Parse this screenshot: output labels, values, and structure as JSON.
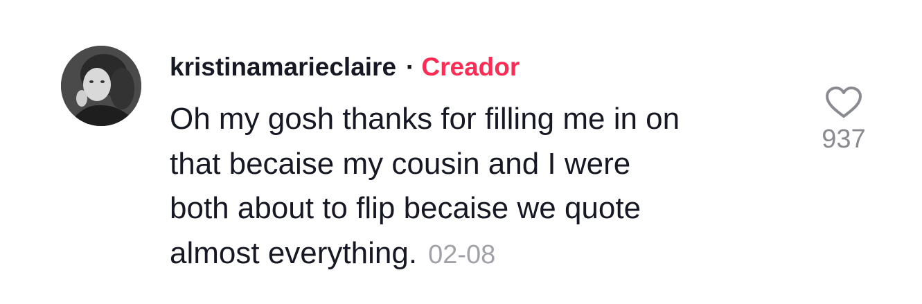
{
  "comment": {
    "username": "kristinamarieclaire",
    "separator": "·",
    "badge": "Creador",
    "text_lines": [
      "Oh my gosh thanks for filling me in on",
      "that becaise my cousin and I were",
      "both about to flip becaise we quote",
      "almost everything."
    ],
    "date": "02-08",
    "like_count": "937",
    "like_icon": "heart-outline-icon",
    "avatar_icon": "user-avatar"
  },
  "colors": {
    "text": "#161823",
    "badge": "#fe2c55",
    "muted": "#a1a2a7"
  }
}
